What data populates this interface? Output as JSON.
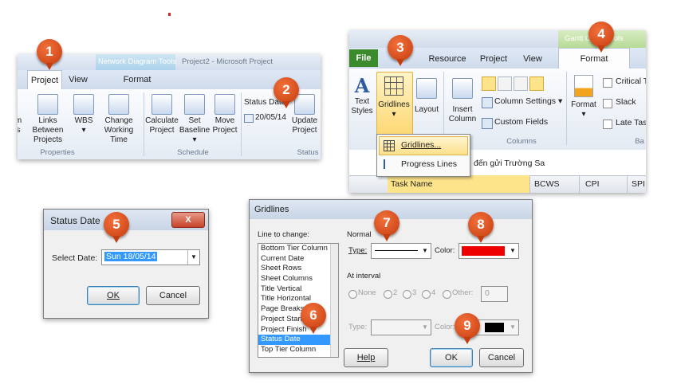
{
  "panel1": {
    "tabs": [
      "Project",
      "View",
      "Format"
    ],
    "context_label": "Network Diagram Tools",
    "window_title": "Project2 - Microsoft Project",
    "commands": [
      {
        "label": "m",
        "sub": "s"
      },
      {
        "label": "Links Between",
        "sub": "Projects"
      },
      {
        "label": "WBS",
        "sub": "▾"
      },
      {
        "label": "Change",
        "sub": "Working Time"
      },
      {
        "label": "Calculate",
        "sub": "Project"
      },
      {
        "label": "Set",
        "sub": "Baseline ▾"
      },
      {
        "label": "Move",
        "sub": "Project"
      },
      {
        "label": "Update",
        "sub": "Project"
      }
    ],
    "status_date_label": "Status Date",
    "status_date_value": "20/05/14",
    "groups": [
      "Properties",
      "Schedule",
      "Status"
    ]
  },
  "panel2": {
    "context_label": "Gantt Chart Tools",
    "tabs": [
      "File",
      "Resource",
      "Project",
      "View",
      "Format"
    ],
    "commands": [
      {
        "label": "Text",
        "sub": "Styles"
      },
      {
        "label": "Gridlines",
        "sub": "▾"
      },
      {
        "label": "Layout",
        "sub": ""
      },
      {
        "label": "Insert",
        "sub": "Column"
      },
      {
        "label": "Format",
        "sub": "▾"
      }
    ],
    "column_settings": "Column Settings ▾",
    "custom_fields": "Custom Fields",
    "columns_group": "Columns",
    "checks": [
      "Critical T",
      "Slack",
      "Late Tas"
    ],
    "bar_group": "Ba",
    "dropdown": [
      "Gridlines...",
      "Progress Lines"
    ],
    "task_text": "đến gửi Trường Sa",
    "table_headers": [
      "Task Name",
      "BCWS",
      "CPI",
      "SPI"
    ]
  },
  "status_dialog": {
    "title": "Status Date",
    "close": "X",
    "label": "Select Date:",
    "value": "Sun 18/05/14",
    "ok": "OK",
    "cancel": "Cancel"
  },
  "gridlines_dialog": {
    "title": "Gridlines",
    "line_to_change": "Line to change:",
    "items": [
      "Bottom Tier Column",
      "Current Date",
      "Sheet Rows",
      "Sheet Columns",
      "Title Vertical",
      "Title Horizontal",
      "Page Breaks",
      "Project Start",
      "Project Finish",
      "Status Date",
      "Top Tier Column"
    ],
    "selected_index": 9,
    "normal_label": "Normal",
    "type_label": "Type:",
    "color_label": "Color:",
    "normal_color": "#ee0000",
    "at_interval_label": "At interval",
    "interval_options": [
      "None",
      "2",
      "3",
      "4",
      "Other:"
    ],
    "other_value": "0",
    "interval_type_label": "Type:",
    "interval_color_label": "Color:",
    "interval_color": "#000000",
    "help": "Help",
    "ok": "OK",
    "cancel": "Cancel"
  },
  "badges": [
    "1",
    "2",
    "3",
    "4",
    "5",
    "6",
    "7",
    "8",
    "9"
  ],
  "colors": {
    "badge": "#d9541e",
    "file_tab": "#3b8a2c",
    "selection": "#3399ff",
    "highlight": "#fde38a"
  }
}
